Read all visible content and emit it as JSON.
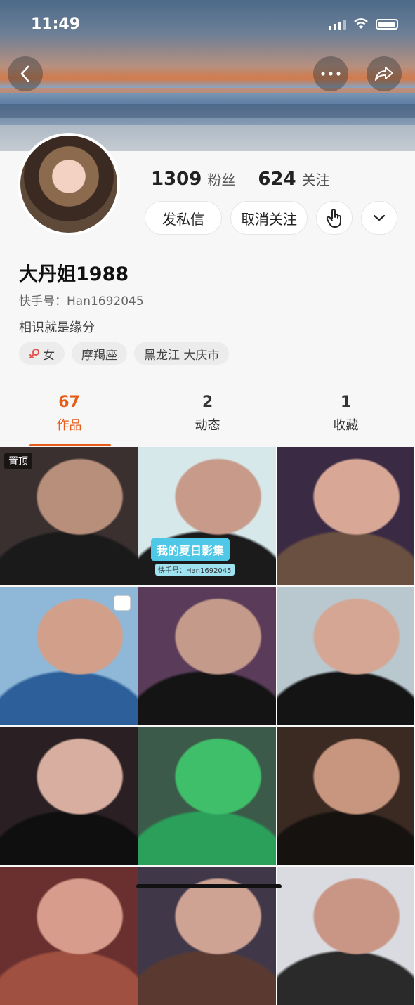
{
  "status_bar": {
    "time": "11:49"
  },
  "header": {
    "back_icon": "chevron-left-icon",
    "more_icon": "more-dots-icon",
    "share_icon": "share-arrow-icon"
  },
  "profile": {
    "followers_count": "1309",
    "followers_label": "粉丝",
    "following_count": "624",
    "following_label": "关注",
    "message_button": "发私信",
    "unfollow_button": "取消关注",
    "name": "大丹姐1988",
    "kuaishou_id": "快手号：Han1692045",
    "bio": "相识就是缘分",
    "tags": [
      {
        "icon": "female-symbol-icon",
        "label": "女"
      },
      {
        "label": "摩羯座"
      },
      {
        "label": "黑龙江 大庆市"
      }
    ]
  },
  "tabs": [
    {
      "count": "67",
      "label": "作品",
      "active": true
    },
    {
      "count": "2",
      "label": "动态",
      "active": false
    },
    {
      "count": "1",
      "label": "收藏",
      "active": false
    }
  ],
  "grid": {
    "pinned_label": "置顶",
    "album_title": "我的夏日影集",
    "album_id": "快手号：Han1692045",
    "items": [
      {
        "colors": [
          "#3a3030",
          "#b88f7a",
          "#1a1a1a"
        ]
      },
      {
        "colors": [
          "#d7e8ea",
          "#c79a8a",
          "#1b1b1b"
        ]
      },
      {
        "colors": [
          "#3a2a44",
          "#d8a796",
          "#6a5040"
        ]
      },
      {
        "colors": [
          "#8fb8d8",
          "#d19f8a",
          "#2d5f9a"
        ]
      },
      {
        "colors": [
          "#5a3c5a",
          "#c49a8a",
          "#141414"
        ]
      },
      {
        "colors": [
          "#b9c7cf",
          "#d4a693",
          "#141414"
        ]
      },
      {
        "colors": [
          "#2a2024",
          "#d7ae9f",
          "#0f0f0f"
        ]
      },
      {
        "colors": [
          "#3c5a4a",
          "#3fbf6a",
          "#2aa05a"
        ]
      },
      {
        "colors": [
          "#3a2a22",
          "#c8967e",
          "#161210"
        ]
      },
      {
        "colors": [
          "#6a3030",
          "#d89c8c",
          "#a05040"
        ]
      },
      {
        "colors": [
          "#403848",
          "#cfa394",
          "#5a3a30"
        ]
      },
      {
        "colors": [
          "#d9dbe0",
          "#c99585",
          "#2a2a2a"
        ]
      }
    ]
  }
}
